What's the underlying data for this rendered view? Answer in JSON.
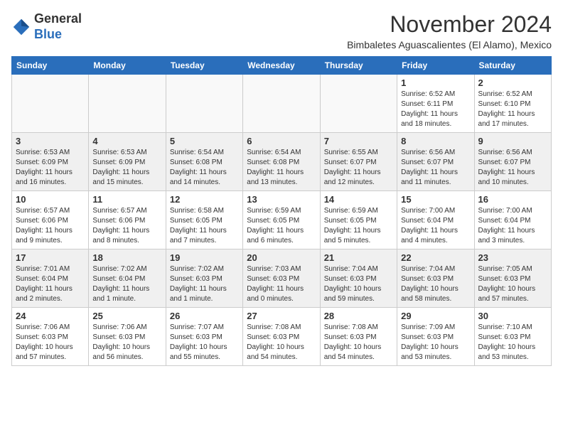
{
  "header": {
    "logo_general": "General",
    "logo_blue": "Blue",
    "month_title": "November 2024",
    "location": "Bimbaletes Aguascalientes (El Alamo), Mexico"
  },
  "weekdays": [
    "Sunday",
    "Monday",
    "Tuesday",
    "Wednesday",
    "Thursday",
    "Friday",
    "Saturday"
  ],
  "weeks": [
    {
      "shaded": false,
      "days": [
        {
          "num": "",
          "detail": ""
        },
        {
          "num": "",
          "detail": ""
        },
        {
          "num": "",
          "detail": ""
        },
        {
          "num": "",
          "detail": ""
        },
        {
          "num": "",
          "detail": ""
        },
        {
          "num": "1",
          "detail": "Sunrise: 6:52 AM\nSunset: 6:11 PM\nDaylight: 11 hours\nand 18 minutes."
        },
        {
          "num": "2",
          "detail": "Sunrise: 6:52 AM\nSunset: 6:10 PM\nDaylight: 11 hours\nand 17 minutes."
        }
      ]
    },
    {
      "shaded": true,
      "days": [
        {
          "num": "3",
          "detail": "Sunrise: 6:53 AM\nSunset: 6:09 PM\nDaylight: 11 hours\nand 16 minutes."
        },
        {
          "num": "4",
          "detail": "Sunrise: 6:53 AM\nSunset: 6:09 PM\nDaylight: 11 hours\nand 15 minutes."
        },
        {
          "num": "5",
          "detail": "Sunrise: 6:54 AM\nSunset: 6:08 PM\nDaylight: 11 hours\nand 14 minutes."
        },
        {
          "num": "6",
          "detail": "Sunrise: 6:54 AM\nSunset: 6:08 PM\nDaylight: 11 hours\nand 13 minutes."
        },
        {
          "num": "7",
          "detail": "Sunrise: 6:55 AM\nSunset: 6:07 PM\nDaylight: 11 hours\nand 12 minutes."
        },
        {
          "num": "8",
          "detail": "Sunrise: 6:56 AM\nSunset: 6:07 PM\nDaylight: 11 hours\nand 11 minutes."
        },
        {
          "num": "9",
          "detail": "Sunrise: 6:56 AM\nSunset: 6:07 PM\nDaylight: 11 hours\nand 10 minutes."
        }
      ]
    },
    {
      "shaded": false,
      "days": [
        {
          "num": "10",
          "detail": "Sunrise: 6:57 AM\nSunset: 6:06 PM\nDaylight: 11 hours\nand 9 minutes."
        },
        {
          "num": "11",
          "detail": "Sunrise: 6:57 AM\nSunset: 6:06 PM\nDaylight: 11 hours\nand 8 minutes."
        },
        {
          "num": "12",
          "detail": "Sunrise: 6:58 AM\nSunset: 6:05 PM\nDaylight: 11 hours\nand 7 minutes."
        },
        {
          "num": "13",
          "detail": "Sunrise: 6:59 AM\nSunset: 6:05 PM\nDaylight: 11 hours\nand 6 minutes."
        },
        {
          "num": "14",
          "detail": "Sunrise: 6:59 AM\nSunset: 6:05 PM\nDaylight: 11 hours\nand 5 minutes."
        },
        {
          "num": "15",
          "detail": "Sunrise: 7:00 AM\nSunset: 6:04 PM\nDaylight: 11 hours\nand 4 minutes."
        },
        {
          "num": "16",
          "detail": "Sunrise: 7:00 AM\nSunset: 6:04 PM\nDaylight: 11 hours\nand 3 minutes."
        }
      ]
    },
    {
      "shaded": true,
      "days": [
        {
          "num": "17",
          "detail": "Sunrise: 7:01 AM\nSunset: 6:04 PM\nDaylight: 11 hours\nand 2 minutes."
        },
        {
          "num": "18",
          "detail": "Sunrise: 7:02 AM\nSunset: 6:04 PM\nDaylight: 11 hours\nand 1 minute."
        },
        {
          "num": "19",
          "detail": "Sunrise: 7:02 AM\nSunset: 6:03 PM\nDaylight: 11 hours\nand 1 minute."
        },
        {
          "num": "20",
          "detail": "Sunrise: 7:03 AM\nSunset: 6:03 PM\nDaylight: 11 hours\nand 0 minutes."
        },
        {
          "num": "21",
          "detail": "Sunrise: 7:04 AM\nSunset: 6:03 PM\nDaylight: 10 hours\nand 59 minutes."
        },
        {
          "num": "22",
          "detail": "Sunrise: 7:04 AM\nSunset: 6:03 PM\nDaylight: 10 hours\nand 58 minutes."
        },
        {
          "num": "23",
          "detail": "Sunrise: 7:05 AM\nSunset: 6:03 PM\nDaylight: 10 hours\nand 57 minutes."
        }
      ]
    },
    {
      "shaded": false,
      "days": [
        {
          "num": "24",
          "detail": "Sunrise: 7:06 AM\nSunset: 6:03 PM\nDaylight: 10 hours\nand 57 minutes."
        },
        {
          "num": "25",
          "detail": "Sunrise: 7:06 AM\nSunset: 6:03 PM\nDaylight: 10 hours\nand 56 minutes."
        },
        {
          "num": "26",
          "detail": "Sunrise: 7:07 AM\nSunset: 6:03 PM\nDaylight: 10 hours\nand 55 minutes."
        },
        {
          "num": "27",
          "detail": "Sunrise: 7:08 AM\nSunset: 6:03 PM\nDaylight: 10 hours\nand 54 minutes."
        },
        {
          "num": "28",
          "detail": "Sunrise: 7:08 AM\nSunset: 6:03 PM\nDaylight: 10 hours\nand 54 minutes."
        },
        {
          "num": "29",
          "detail": "Sunrise: 7:09 AM\nSunset: 6:03 PM\nDaylight: 10 hours\nand 53 minutes."
        },
        {
          "num": "30",
          "detail": "Sunrise: 7:10 AM\nSunset: 6:03 PM\nDaylight: 10 hours\nand 53 minutes."
        }
      ]
    }
  ]
}
